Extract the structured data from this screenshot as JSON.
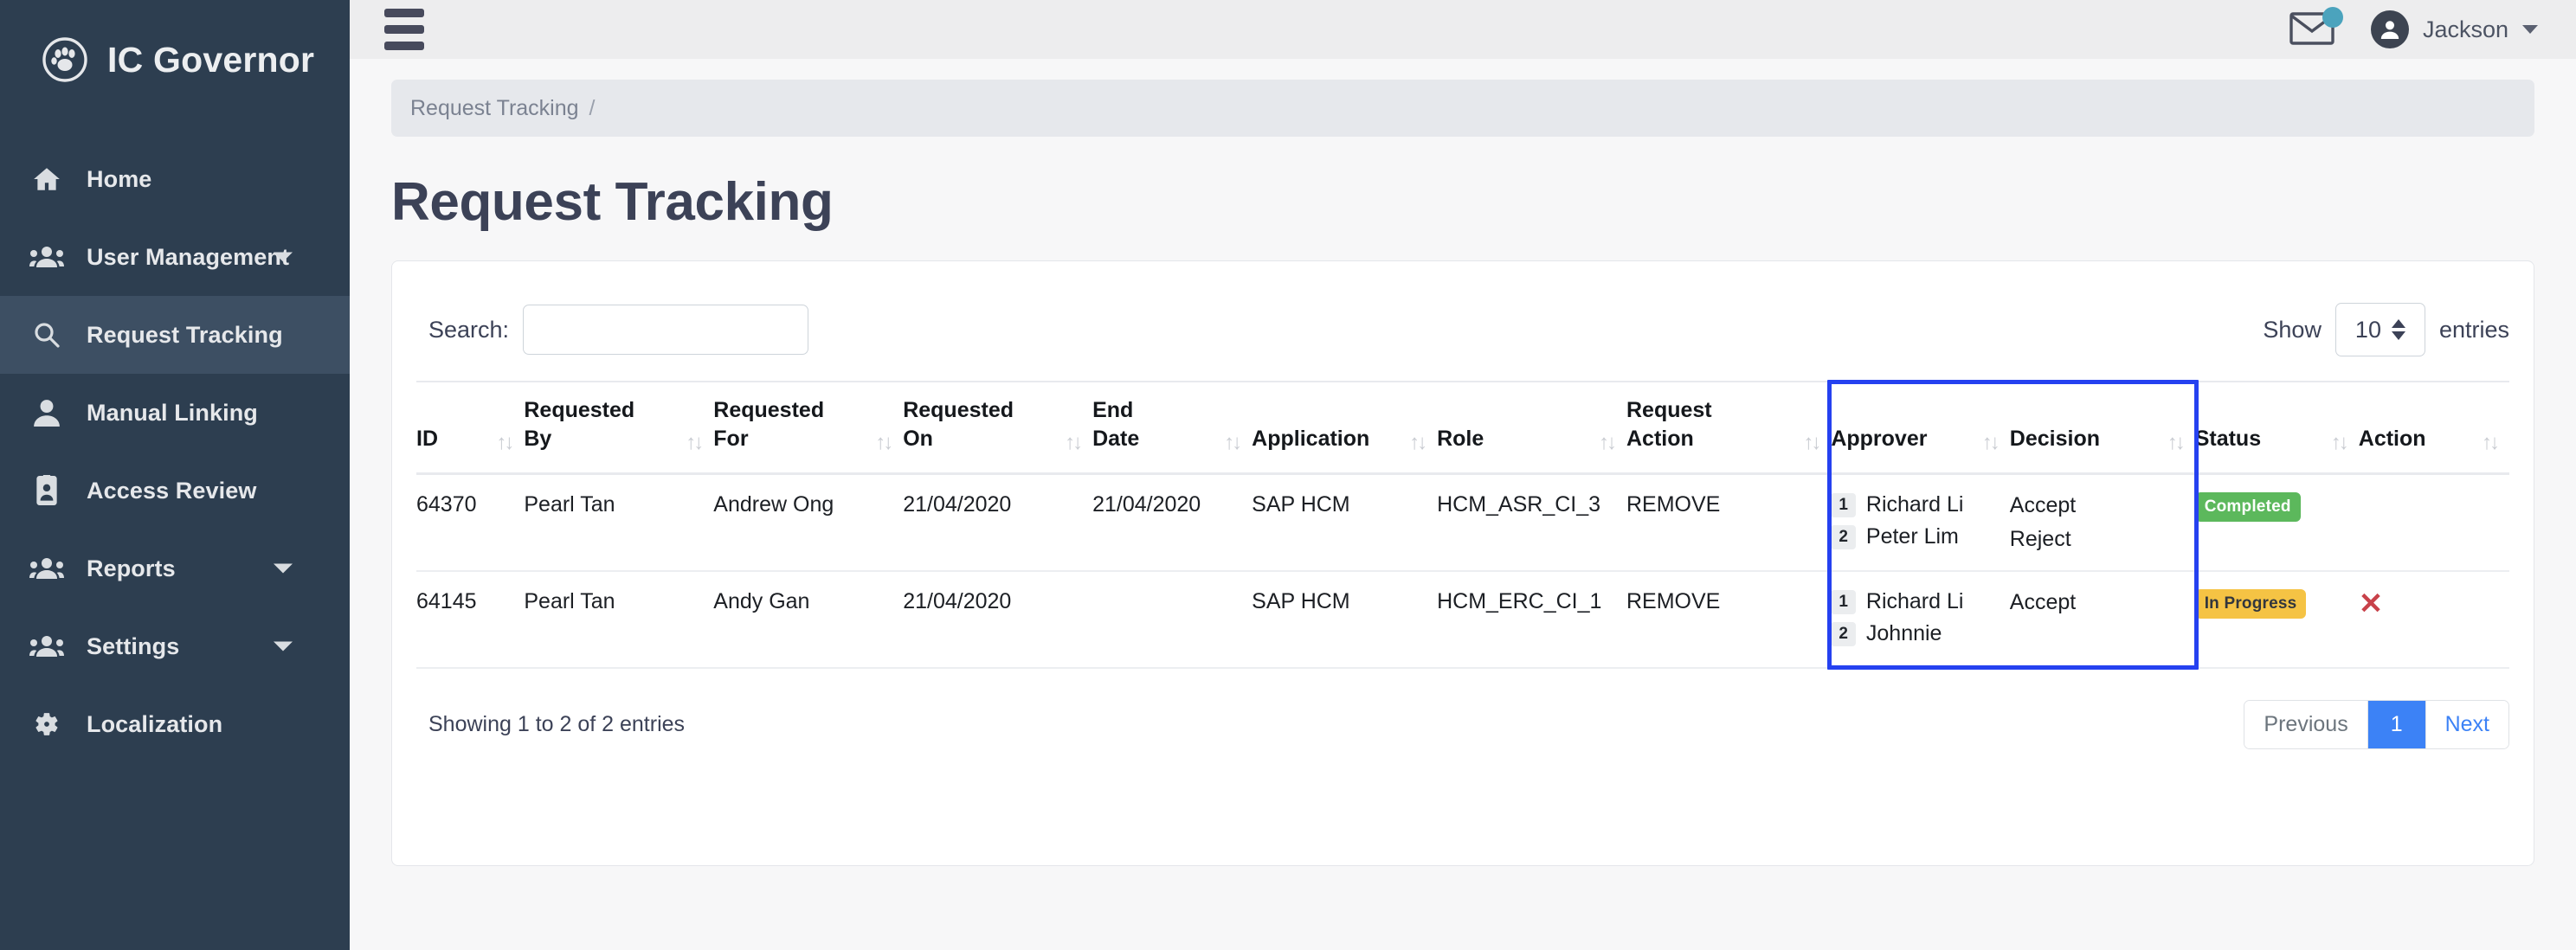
{
  "brand": {
    "title": "IC Governor",
    "logo_icon": "paw-in-circle-icon"
  },
  "sidebar": {
    "items": [
      {
        "label": "Home",
        "icon": "home-icon",
        "active": false,
        "caret": false
      },
      {
        "label": "User Management",
        "icon": "users-icon",
        "active": false,
        "caret": true
      },
      {
        "label": "Request Tracking",
        "icon": "search-icon",
        "active": true,
        "caret": false
      },
      {
        "label": "Manual Linking",
        "icon": "user-icon",
        "active": false,
        "caret": false
      },
      {
        "label": "Access Review",
        "icon": "id-badge-icon",
        "active": false,
        "caret": false
      },
      {
        "label": "Reports",
        "icon": "users-icon",
        "active": false,
        "caret": true
      },
      {
        "label": "Settings",
        "icon": "users-icon",
        "active": false,
        "caret": true
      },
      {
        "label": "Localization",
        "icon": "gear-icon",
        "active": false,
        "caret": false
      }
    ]
  },
  "topbar": {
    "menu_icon": "hamburger-icon",
    "mail_icon": "envelope-icon",
    "mail_badge": "",
    "user_name": "Jackson",
    "avatar_icon": "user-avatar-icon"
  },
  "breadcrumb": {
    "current": "Request Tracking",
    "separator": "/"
  },
  "page": {
    "title": "Request Tracking"
  },
  "controls": {
    "search_label": "Search:",
    "search_value": "",
    "search_placeholder": "",
    "show_label": "Show",
    "entries_value": "10",
    "entries_label": "entries"
  },
  "table": {
    "columns": [
      {
        "label": "ID",
        "sort": "↑↓"
      },
      {
        "label": "Requested\nBy",
        "sort": "↑↓"
      },
      {
        "label": "Requested\nFor",
        "sort": "↑↓"
      },
      {
        "label": "Requested\nOn",
        "sort": "↑↓"
      },
      {
        "label": "End\nDate",
        "sort": "↑↓"
      },
      {
        "label": "Application",
        "sort": "↑↓"
      },
      {
        "label": "Role",
        "sort": "↑↓"
      },
      {
        "label": "Request\nAction",
        "sort": "↑↓"
      },
      {
        "label": "Approver",
        "sort": "↑↓"
      },
      {
        "label": "Decision",
        "sort": "↑↓"
      },
      {
        "label": "Status",
        "sort": "↑↓"
      },
      {
        "label": "Action",
        "sort": "↑↓"
      }
    ],
    "rows": [
      {
        "id": "64370",
        "requested_by": "Pearl Tan",
        "requested_for": "Andrew Ong",
        "requested_on": "21/04/2020",
        "end_date": "21/04/2020",
        "application": "SAP HCM",
        "role": "HCM_ASR_CI_3",
        "request_action": "REMOVE",
        "approvers": [
          {
            "num": "1",
            "name": "Richard Li"
          },
          {
            "num": "2",
            "name": "Peter Lim"
          }
        ],
        "decisions": [
          "Accept",
          "Reject"
        ],
        "status": "Completed",
        "status_kind": "completed",
        "action_icon": ""
      },
      {
        "id": "64145",
        "requested_by": "Pearl Tan",
        "requested_for": "Andy Gan",
        "requested_on": "21/04/2020",
        "end_date": "",
        "application": "SAP HCM",
        "role": "HCM_ERC_CI_1",
        "request_action": "REMOVE",
        "approvers": [
          {
            "num": "1",
            "name": "Richard Li"
          },
          {
            "num": "2",
            "name": "Johnnie"
          }
        ],
        "decisions": [
          "Accept",
          ""
        ],
        "status": "In Progress",
        "status_kind": "inprogress",
        "action_icon": "✕"
      }
    ]
  },
  "footer": {
    "showing": "Showing 1 to 2 of 2 entries",
    "previous": "Previous",
    "page_number": "1",
    "next": "Next"
  },
  "colors": {
    "sidebar_bg": "#2d3e50",
    "sidebar_active": "#3d4f63",
    "accent_blue": "#3c82f6",
    "highlight_border": "#2541f0",
    "status_completed": "#5cb85c",
    "status_inprogress": "#f5c344",
    "action_red": "#c8424a",
    "mail_badge": "#4ba3bd"
  }
}
